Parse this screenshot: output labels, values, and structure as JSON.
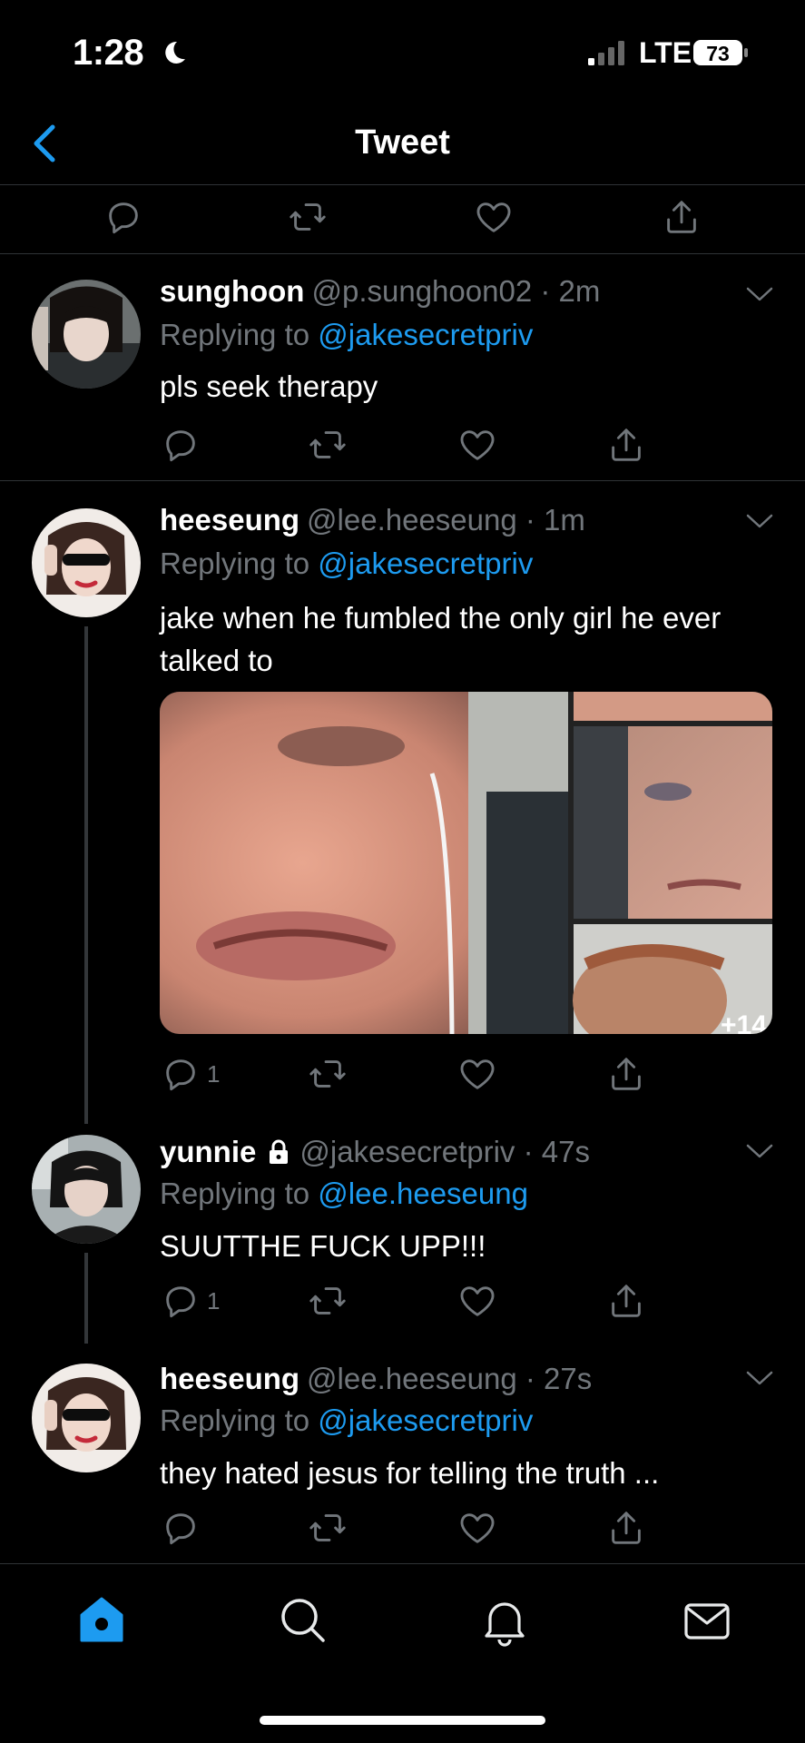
{
  "status": {
    "time": "1:28",
    "carrier": "LTE",
    "battery": "73"
  },
  "header": {
    "title": "Tweet"
  },
  "tweets": [
    {
      "name": "sunghoon",
      "handle": "@p.sunghoon02 · 2m",
      "replying_prefix": "Replying to",
      "replying_to": "@jakesecretpriv",
      "text": "pls seek therapy",
      "reply_count": ""
    },
    {
      "name": "heeseung",
      "handle": "@lee.heeseung · 1m",
      "replying_prefix": "Replying to",
      "replying_to": "@jakesecretpriv",
      "text": "jake when he fumbled the only girl he ever talked to",
      "reply_count": "1",
      "media_more": "+14"
    },
    {
      "name": "yunnie",
      "handle": "@jakesecretpriv · 47s",
      "replying_prefix": "Replying to",
      "replying_to": "@lee.heeseung",
      "text": "SUUTTHE FUCK UPP!!!",
      "reply_count": "1"
    },
    {
      "name": "heeseung",
      "handle": "@lee.heeseung · 27s",
      "replying_prefix": "Replying to",
      "replying_to": "@jakesecretpriv",
      "text": "they hated jesus for telling the truth ...",
      "reply_count": ""
    }
  ],
  "icons": {
    "reply": "reply-icon",
    "retweet": "retweet-icon",
    "like": "heart-icon",
    "share": "share-icon",
    "tabs": [
      "home-icon",
      "search-icon",
      "notifications-icon",
      "messages-icon"
    ]
  },
  "colors": {
    "accent": "#1d9bf0",
    "muted": "#71767b",
    "background": "#000000"
  }
}
